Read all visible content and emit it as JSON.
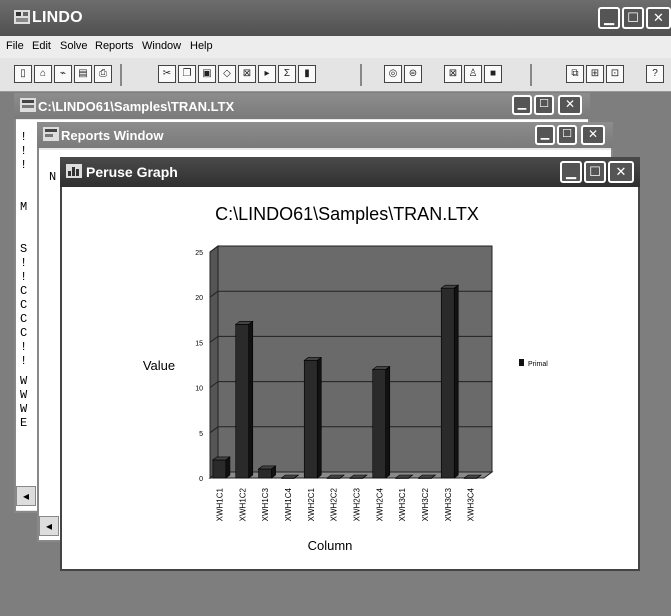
{
  "app": {
    "title": "LINDO"
  },
  "menu": [
    "File",
    "Edit",
    "Solve",
    "Reports",
    "Window",
    "Help"
  ],
  "toolbar_icons": [
    "new-file-icon",
    "open-file-icon",
    "open-report-icon",
    "save-icon",
    "print-icon",
    "cut-icon",
    "copy-icon",
    "paste-icon",
    "clear-icon",
    "find-icon",
    "goto-icon",
    "sum-icon",
    "close-icon",
    "solve-icon",
    "compile-icon",
    "options-icon",
    "peruse-icon",
    "picture-icon",
    "cascade-icon",
    "tile-icon",
    "arrange-icon",
    "help-icon"
  ],
  "doc_window": {
    "title": "C:\\LINDO61\\Samples\\TRAN.LTX",
    "margin_lines": [
      "!",
      "!",
      "!",
      "M",
      "S",
      "!",
      "!",
      "C",
      "C",
      "C",
      "C",
      "!",
      "!",
      "W",
      "W",
      "W",
      "E"
    ]
  },
  "reports_window": {
    "title": "Reports Window",
    "partial_text": "N"
  },
  "graph_window": {
    "title": "Peruse Graph"
  },
  "chart_data": {
    "type": "bar",
    "title": "C:\\LINDO61\\Samples\\TRAN.LTX",
    "xlabel": "Column",
    "ylabel": "Value",
    "ylim": [
      0,
      25
    ],
    "yticks": [
      0,
      5,
      10,
      15,
      20,
      25
    ],
    "categories": [
      "XWH1C1",
      "XWH1C2",
      "XWH1C3",
      "XWH1C4",
      "XWH2C1",
      "XWH2C2",
      "XWH2C3",
      "XWH2C4",
      "XWH3C1",
      "XWH3C2",
      "XWH3C3",
      "XWH3C4"
    ],
    "series": [
      {
        "name": "Primal",
        "values": [
          2,
          17,
          1,
          0,
          13,
          0,
          0,
          12,
          0,
          0,
          21,
          0
        ]
      }
    ],
    "legend_position": "right",
    "grid": true,
    "colors": {
      "bar_front": "#2a2a2a",
      "bar_top": "#444444",
      "bar_side": "#111111",
      "plot_bg": "#6a6a6a",
      "floor": "#8a8a8a"
    }
  }
}
